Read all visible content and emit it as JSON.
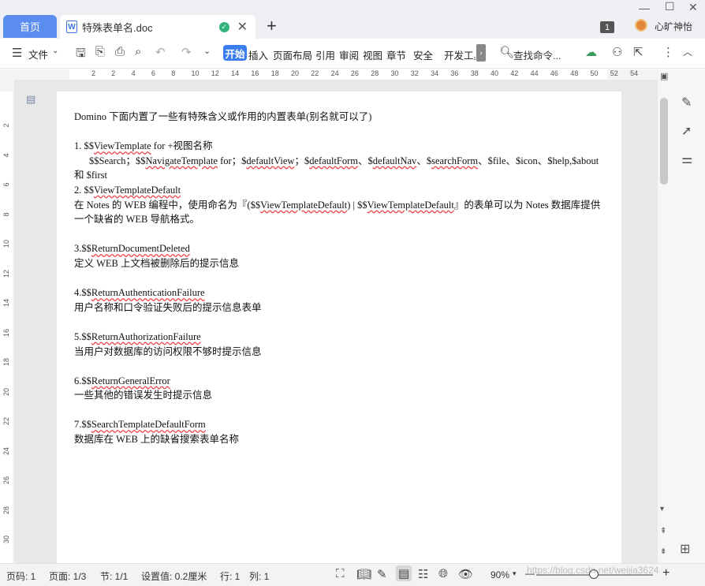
{
  "tabs": {
    "home": "首页",
    "doc_title": "特殊表单名.doc",
    "add": "+"
  },
  "window": {
    "minimize": "—",
    "maximize": "☐",
    "close": "✕",
    "badge": "1",
    "user": "心旷神怡"
  },
  "toolbar": {
    "file": "文件",
    "start": "开始",
    "insert": "插入",
    "layout": "页面布局",
    "reference": "引用",
    "review": "审阅",
    "view": "视图",
    "chapter": "章节",
    "security": "安全",
    "devtools": "开发工具",
    "search": "查找命令..."
  },
  "ruler": {
    "h_ticks": [
      "2",
      "2",
      "4",
      "6",
      "8",
      "10",
      "12",
      "14",
      "16",
      "18",
      "20",
      "22",
      "24",
      "26",
      "28",
      "30",
      "32",
      "34",
      "36",
      "38",
      "40",
      "42",
      "44",
      "46",
      "48",
      "50",
      "52",
      "54"
    ],
    "v_ticks": [
      "2",
      "4",
      "6",
      "8",
      "10",
      "12",
      "14",
      "16",
      "18",
      "20",
      "22",
      "24",
      "26",
      "28",
      "30"
    ]
  },
  "document": {
    "l1": "Domino 下面内置了一些有特殊含义或作用的内置表单(别名就可以了)",
    "l2a": "1. $$",
    "l2b": "ViewTemplate",
    "l2c": " for +视图名称",
    "l3a": "$$Search；$$",
    "l3b": "NavigateTemplate",
    "l3c": " for；$",
    "l3d": "defaultView",
    "l3e": "；$",
    "l3f": "defaultForm",
    "l3g": "、$",
    "l3h": "defaultNav",
    "l3i": "、$",
    "l3j": "searchForm",
    "l3k": "、$file、$icon、$help,$about",
    "l4": "和 $first",
    "l5a": "2. $$",
    "l5b": "ViewTemplateDefault",
    "l6a": "在 Notes 的 WEB 编程中，使用命名为『($$",
    "l6b": "ViewTemplateDefault",
    "l6c": ") | $$",
    "l6d": "ViewTemplateDefault",
    "l6e": "』的表单可以为 Notes 数据库提供",
    "l7": "一个缺省的 WEB 导航格式。",
    "l8a": "3.$$",
    "l8b": "ReturnDocumentDeleted",
    "l9": "定义 WEB 上文档被删除后的提示信息",
    "l10a": "4.$$",
    "l10b": "ReturnAuthenticationFailure",
    "l11": "用户名称和口令验证失败后的提示信息表单",
    "l12a": "5.$$",
    "l12b": "ReturnAuthorizationFailure",
    "l13": "当用户对数据库的访问权限不够时提示信息",
    "l14a": "6.$$",
    "l14b": "ReturnGeneralError",
    "l15": "一些其他的错误发生时提示信息",
    "l16a": "7.$$",
    "l16b": "SearchTemplateDefaultForm",
    "l17": "数据库在 WEB 上的缺省搜索表单名称"
  },
  "status": {
    "page_no": "页码: 1",
    "page": "页面: 1/3",
    "section": "节: 1/1",
    "setting": "设置值: 0.2厘米",
    "row": "行: 1",
    "col": "列: 1",
    "zoom": "90%",
    "minus": "—",
    "plus": "+",
    "watermark": "https://blog.csdn.net/weijia3624"
  }
}
